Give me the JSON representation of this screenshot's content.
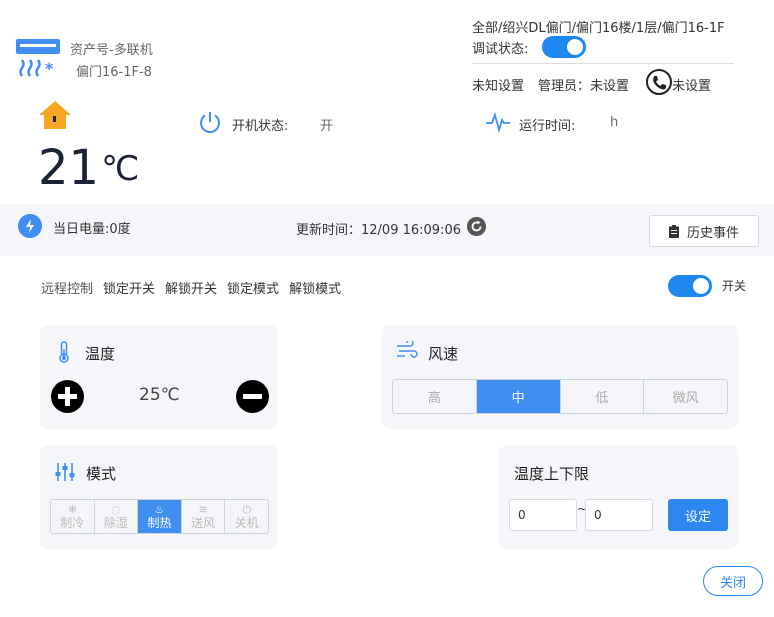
{
  "header": {
    "asset_name": "资产号-多联机",
    "device_id": "偏门16-1F-8",
    "location_path": "全部/绍兴DL偏门/偏门16楼/1层/偏门16-1F",
    "debug_label": "调试状态:",
    "debug_on": true,
    "unknown_setting": "未知设置",
    "admin_label": "管理员：未设置",
    "phone_label": "未设置"
  },
  "status": {
    "current_temp": "21",
    "temp_unit": "℃",
    "power_label": "开机状态:",
    "power_value": "开",
    "runtime_label": "运行时间:",
    "runtime_value": "h"
  },
  "info_bar": {
    "energy_label": "当日电量:0度",
    "update_label": "更新时间：12/09 16:09:06",
    "history_button": "历史事件"
  },
  "controls": {
    "items": [
      "远程控制",
      "锁定开关",
      "解锁开关",
      "锁定模式",
      "解锁模式"
    ],
    "switch_label": "开关",
    "switch_on": true
  },
  "temperature_card": {
    "title": "温度",
    "set_temp": "25℃"
  },
  "wind_card": {
    "title": "风速",
    "options": [
      "高",
      "中",
      "低",
      "微风"
    ],
    "selected": "中"
  },
  "mode_card": {
    "title": "模式",
    "options": [
      {
        "label": "制冷",
        "icon": "snowflake-icon"
      },
      {
        "label": "除湿",
        "icon": "droplet-icon"
      },
      {
        "label": "制热",
        "icon": "flame-icon"
      },
      {
        "label": "送风",
        "icon": "wind-icon"
      },
      {
        "label": "关机",
        "icon": "power-icon"
      }
    ],
    "selected": "制热"
  },
  "range_card": {
    "title": "温度上下限",
    "low_value": "0",
    "high_value": "0",
    "separator": "~",
    "set_button": "设定"
  },
  "footer": {
    "close_button": "关闭"
  },
  "colors": {
    "accent": "#3f8ef0",
    "home_icon": "#f6a623"
  }
}
